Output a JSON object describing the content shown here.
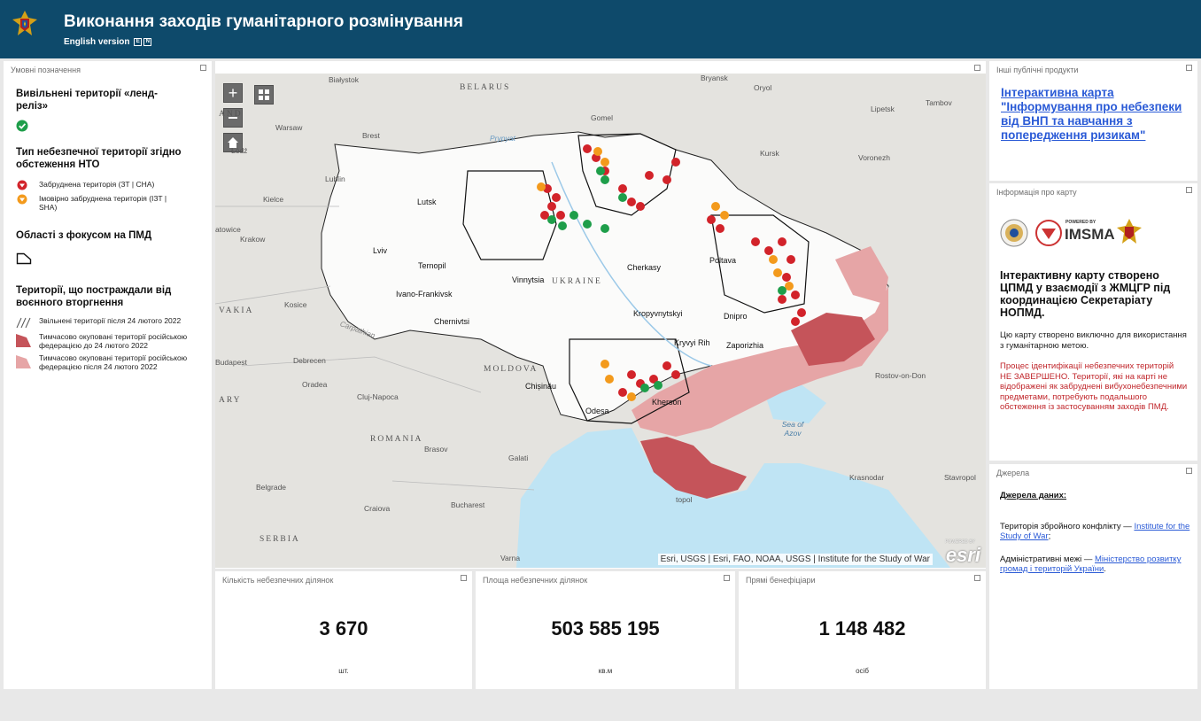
{
  "header": {
    "title": "Виконання заходів гуманітарного розмінування",
    "english_version": "English version",
    "lang_e": "E",
    "lang_n": "N"
  },
  "legend": {
    "panel_title": "Умовні позначення",
    "released_heading": "Вивільнені території «ленд-реліз»",
    "hazard_type_heading": "Тип небезпечної території згідно обстеження НТО",
    "confirmed_label": "Забруднена територія (ЗТ | CHA)",
    "suspected_label": "Імовірно забруднена територія (ІЗТ | SHA)",
    "focus_heading": "Області з фокусом на ПМД",
    "affected_heading": "Території, що постраждали від воєнного вторгнення",
    "liberated_label": "Звільнені території після 24 лютого 2022",
    "occupied_before_label": "Тимчасово окуповані території російською федерацією до 24 лютого 2022",
    "occupied_after_label": "Тимчасово окуповані території російською федерацією після 24 лютого 2022",
    "colors": {
      "released": "#1e9e4a",
      "confirmed": "#d2232a",
      "suspected": "#f39a1c",
      "occupied_before": "#c5545a",
      "occupied_after": "#e6a5a6"
    }
  },
  "map": {
    "zoom_in": "+",
    "attribution": "Esri, USGS | Esri, FAO, NOAA, USGS | Institute for the Study of War",
    "esri_logo": "esri",
    "powered_by": "POWERED BY",
    "labels": {
      "belarus": "BELARUS",
      "ukraine": "UKRAINE",
      "romania": "ROMANIA",
      "moldova": "MOLDOVA",
      "serbia": "SERBIA",
      "vakia": "VAKIA",
      "ary": "ARY",
      "and": "AND",
      "sea_of_azov": "Sea of Azov",
      "bialystok": "Białystok",
      "oryol": "Oryol",
      "lipetsk": "Lipetsk",
      "tambov": "Tambov",
      "warsaw": "Warsaw",
      "brest": "Brest",
      "gomel": "Gomel",
      "pripyat": "Prypyat",
      "kursk": "Kursk",
      "voronezh": "Voronezh",
      "lodz": "Łódź",
      "lublin": "Lublin",
      "kielce": "Kielce",
      "lutsk": "Lutsk",
      "krakow": "Krakow",
      "atowice": "atowice",
      "lviv": "Lviv",
      "ternopil": "Ternopil",
      "ivano_frankivsk": "Ivano-Frankivsk",
      "kosice": "Kosice",
      "chernivtsi": "Chernivtsi",
      "carpathian": "Carpathian",
      "vinnytsia": "Vinnytsia",
      "cherkasy": "Cherkasy",
      "poltava": "Poltava",
      "kropyvnytskyi": "Kropyvnytskyi",
      "dnipro": "Dnipro",
      "zaporizhia": "Zaporizhia",
      "kryvyi_rih": "Kryvyi Rih",
      "budapest": "Budapest",
      "debrecen": "Debrecen",
      "oradea": "Oradea",
      "cluj": "Cluj-Napoca",
      "chisinau": "Chișinău",
      "odesa": "Odesa",
      "kherson": "Kherson",
      "rostov": "Rostov-on-Don",
      "brasov": "Brasov",
      "galati": "Galati",
      "krasnodar": "Krasnodar",
      "stavropol": "Stavropol",
      "belgrade": "Belgrade",
      "craiova": "Craiova",
      "bucharest": "Bucharest",
      "varna": "Varna",
      "sevastopol": "topol",
      "bryansk": "Bryansk"
    }
  },
  "stats": [
    {
      "title": "Кількість небезпечних ділянок",
      "value": "3 670",
      "unit": "шт."
    },
    {
      "title": "Площа небезпечних ділянок",
      "value": "503 585 195",
      "unit": "кв.м"
    },
    {
      "title": "Прямі бенефіціари",
      "value": "1 148 482",
      "unit": "осіб"
    }
  ],
  "other_products": {
    "panel_title": "Інші публічні продукти",
    "link_text": "Інтерактивна карта \"Інформування про небезпеки від ВНП та навчання з попередження ризикам\""
  },
  "map_info": {
    "panel_title": "Інформація про карту",
    "powered_by": "POWERED BY",
    "imsma": "IMSMA",
    "heading": "Інтерактивну карту створено ЦПМД у взаємодії з ЖМЦГР під координацією Секретаріату НОПМД.",
    "note": "Цю карту створено виключно для використання з гуманітарною метою.",
    "warning": "Процес ідентифікації небезпечних територій НЕ ЗАВЕРШЕНО. Території, які на карті не відображені як забруднені вибухонебезпечними предметами, потребують подальшого обстеження із застосуванням заходів ПМД."
  },
  "sources": {
    "panel_title": "Джерела",
    "heading": "Джерела даних:",
    "conflict_prefix": "Територія збройного конфлікту — ",
    "conflict_link": "Institute for the Study of War",
    "conflict_suffix": ";",
    "admin_prefix": "Адміністративні межі — ",
    "admin_link": "Міністерство розвитку громад  і територій України",
    "admin_suffix": "."
  }
}
